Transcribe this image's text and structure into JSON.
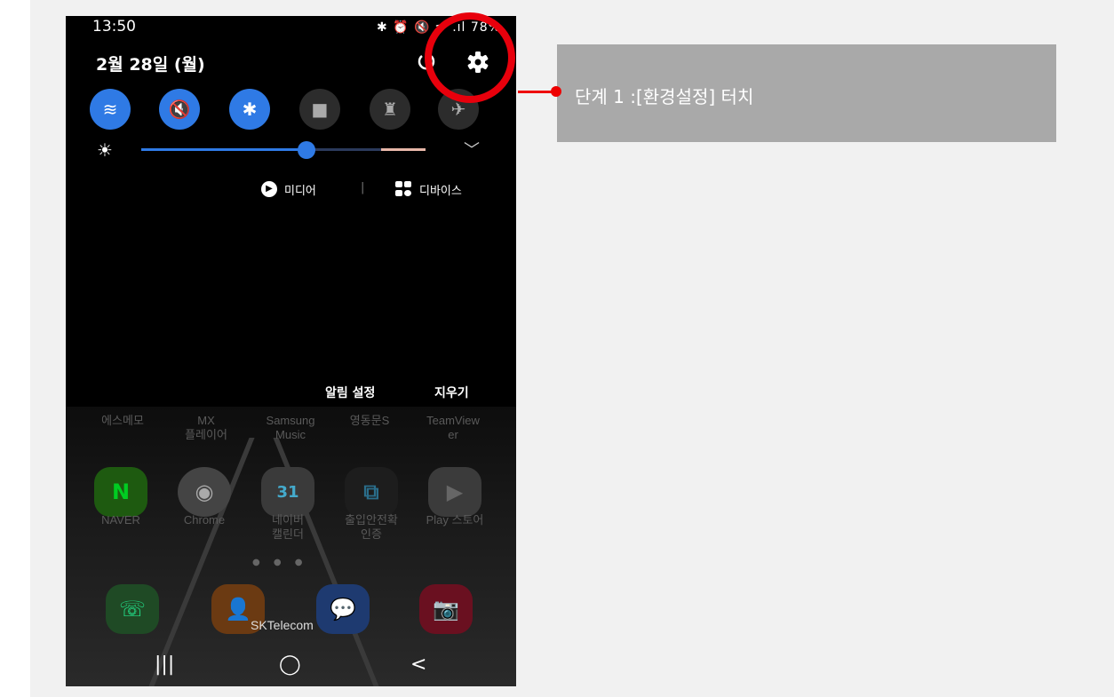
{
  "status_bar": {
    "time": "13:50",
    "icons": "✱ ⏰ 🔇 ᯤ .ıl 78%",
    "battery_icon": "battery-icon"
  },
  "panel": {
    "date": "2월 28일 (월)",
    "media_label": "미디어",
    "devices_label": "디바이스",
    "notification_settings": "알림 설정",
    "clear": "지우기"
  },
  "quick_settings": [
    {
      "name": "wifi",
      "glyph": "≋",
      "on": true
    },
    {
      "name": "mute",
      "glyph": "🔇",
      "on": true
    },
    {
      "name": "bluetooth",
      "glyph": "✱",
      "on": true
    },
    {
      "name": "lock",
      "glyph": "■",
      "on": false
    },
    {
      "name": "flashlight",
      "glyph": "♜",
      "on": false
    },
    {
      "name": "airplane",
      "glyph": "✈",
      "on": false
    }
  ],
  "brightness_level": 0.58,
  "apps_row1": [
    {
      "label": "에스메모"
    },
    {
      "label": "MX\n플레이어"
    },
    {
      "label": "Samsung\nMusic"
    },
    {
      "label": "영동문S"
    },
    {
      "label": "TeamView\ner"
    }
  ],
  "apps_row2": [
    {
      "label": "NAVER",
      "glyph": "N",
      "color": "#2db400"
    },
    {
      "label": "Chrome",
      "glyph": "◉",
      "color": "#bbbbbb"
    },
    {
      "label": "네이버\n캘린더",
      "glyph": "31",
      "color": "#ffffff"
    },
    {
      "label": "출입안전확\n인증",
      "glyph": "⧉",
      "color": "#dddddd"
    },
    {
      "label": "Play 스토어",
      "glyph": "▶",
      "color": "#ffffff"
    }
  ],
  "dock": [
    {
      "name": "phone",
      "color": "#2e8a3a"
    },
    {
      "name": "contacts",
      "color": "#e07a20"
    },
    {
      "name": "messages",
      "color": "#2d6bd8"
    },
    {
      "name": "camera",
      "color": "#d8213a"
    }
  ],
  "carrier": "SKTelecom",
  "nav": {
    "recents": "|||",
    "home": "◯",
    "back": "<"
  },
  "annotation": {
    "text": "단계 1 :[환경설정] 터치"
  }
}
